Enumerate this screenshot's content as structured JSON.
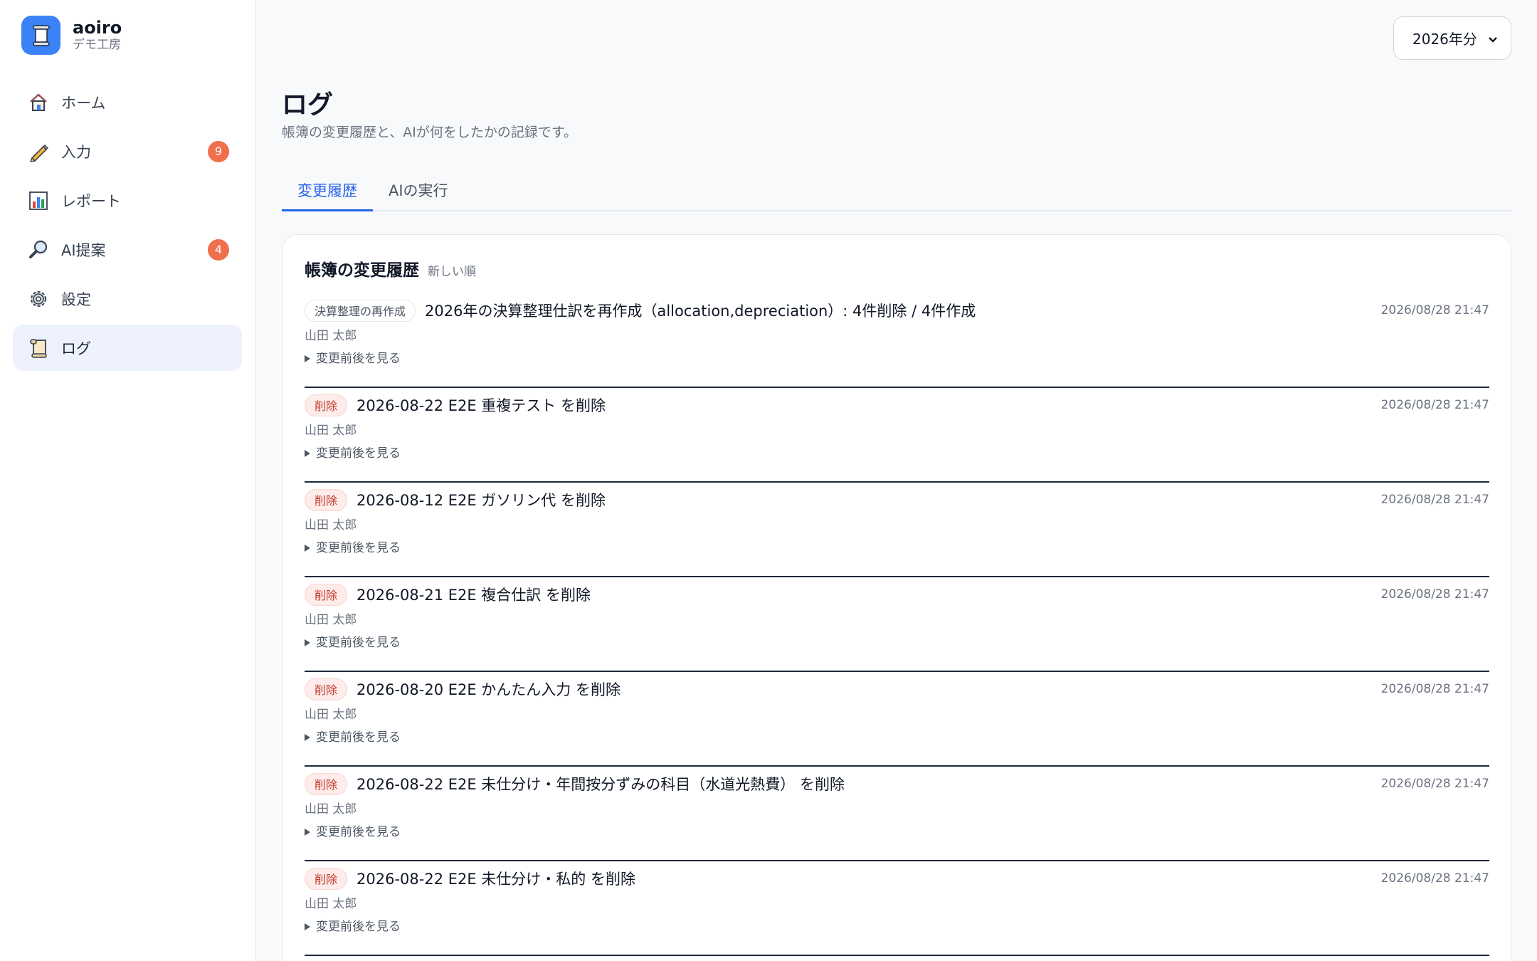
{
  "app": {
    "name": "aoiro",
    "subtitle": "デモ工房"
  },
  "sidebar": {
    "items": [
      {
        "label": "ホーム",
        "icon": "house-icon",
        "badge": null,
        "active": false
      },
      {
        "label": "入力",
        "icon": "pencil-icon",
        "badge": "9",
        "active": false
      },
      {
        "label": "レポート",
        "icon": "bar-chart-icon",
        "badge": null,
        "active": false
      },
      {
        "label": "AI提案",
        "icon": "magnifier-icon",
        "badge": "4",
        "active": false
      },
      {
        "label": "設定",
        "icon": "gear-icon",
        "badge": null,
        "active": false
      },
      {
        "label": "ログ",
        "icon": "scroll-icon",
        "badge": null,
        "active": true
      }
    ]
  },
  "year_select": {
    "value": "2026年分"
  },
  "page": {
    "title": "ログ",
    "description": "帳簿の変更履歴と、AIが何をしたかの記録です。"
  },
  "tabs": [
    {
      "label": "変更履歴",
      "active": true
    },
    {
      "label": "AIの実行",
      "active": false
    }
  ],
  "history": {
    "title": "帳簿の変更履歴",
    "sort": "新しい順",
    "toggle_label": "変更前後を見る",
    "entries": [
      {
        "tag": "決算整理の再作成",
        "tag_type": "neutral",
        "title": "2026年の決算整理仕訳を再作成（allocation,depreciation）: 4件削除 / 4件作成",
        "user": "山田 太郎",
        "time": "2026/08/28 21:47"
      },
      {
        "tag": "削除",
        "tag_type": "delete",
        "title": "2026-08-22 E2E 重複テスト を削除",
        "user": "山田 太郎",
        "time": "2026/08/28 21:47"
      },
      {
        "tag": "削除",
        "tag_type": "delete",
        "title": "2026-08-12 E2E ガソリン代 を削除",
        "user": "山田 太郎",
        "time": "2026/08/28 21:47"
      },
      {
        "tag": "削除",
        "tag_type": "delete",
        "title": "2026-08-21 E2E 複合仕訳 を削除",
        "user": "山田 太郎",
        "time": "2026/08/28 21:47"
      },
      {
        "tag": "削除",
        "tag_type": "delete",
        "title": "2026-08-20 E2E かんたん入力 を削除",
        "user": "山田 太郎",
        "time": "2026/08/28 21:47"
      },
      {
        "tag": "削除",
        "tag_type": "delete",
        "title": "2026-08-22 E2E 未仕分け・年間按分ずみの科目（水道光熱費） を削除",
        "user": "山田 太郎",
        "time": "2026/08/28 21:47"
      },
      {
        "tag": "削除",
        "tag_type": "delete",
        "title": "2026-08-22 E2E 未仕分け・私的 を削除",
        "user": "山田 太郎",
        "time": "2026/08/28 21:47"
      }
    ]
  },
  "colors": {
    "accent": "#2563eb",
    "badge": "#f06f4d",
    "delete_tag_text": "#c0392b",
    "logo_bg": "#3b82f6"
  }
}
